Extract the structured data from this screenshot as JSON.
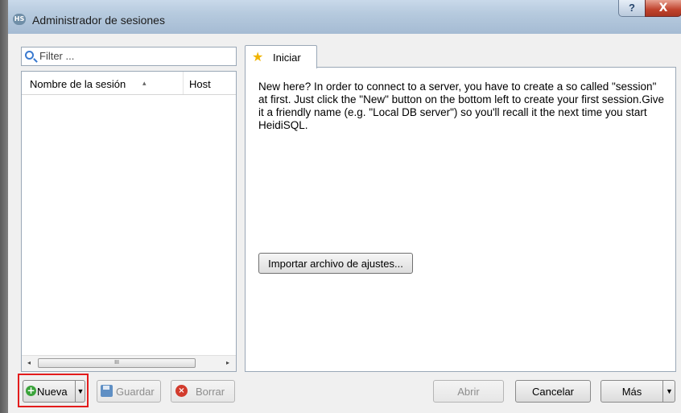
{
  "window": {
    "title": "Administrador de sesiones",
    "app_icon_text": "HS",
    "help_glyph": "?",
    "close_glyph": "X"
  },
  "sessions": {
    "filter_placeholder": "Filter ...",
    "columns": [
      "Nombre de la sesión",
      "Host"
    ],
    "sort_glyph": "▴",
    "rows": [],
    "scroll_left_glyph": "◂",
    "scroll_right_glyph": "▸",
    "scroll_grip": "III"
  },
  "tabs": [
    {
      "label": "Iniciar",
      "icon": "star-icon",
      "active": true
    }
  ],
  "welcome": {
    "text": "New here? In order to connect to a server, you have to create a so called \"session\" at first. Just click the \"New\" button on the bottom left to create your first session.Give it a friendly name (e.g. \"Local DB server\") so you'll recall it the next time you start HeidiSQL.",
    "import_label": "Importar archivo de ajustes..."
  },
  "buttons": {
    "new": "Nueva",
    "save": "Guardar",
    "delete": "Borrar",
    "open": "Abrir",
    "cancel": "Cancelar",
    "more": "Más",
    "dropdown_glyph": "▼",
    "plus_glyph": "+",
    "x_glyph": "×"
  },
  "colors": {
    "highlight": "#e31c1c",
    "accent": "#3a7ad0"
  }
}
